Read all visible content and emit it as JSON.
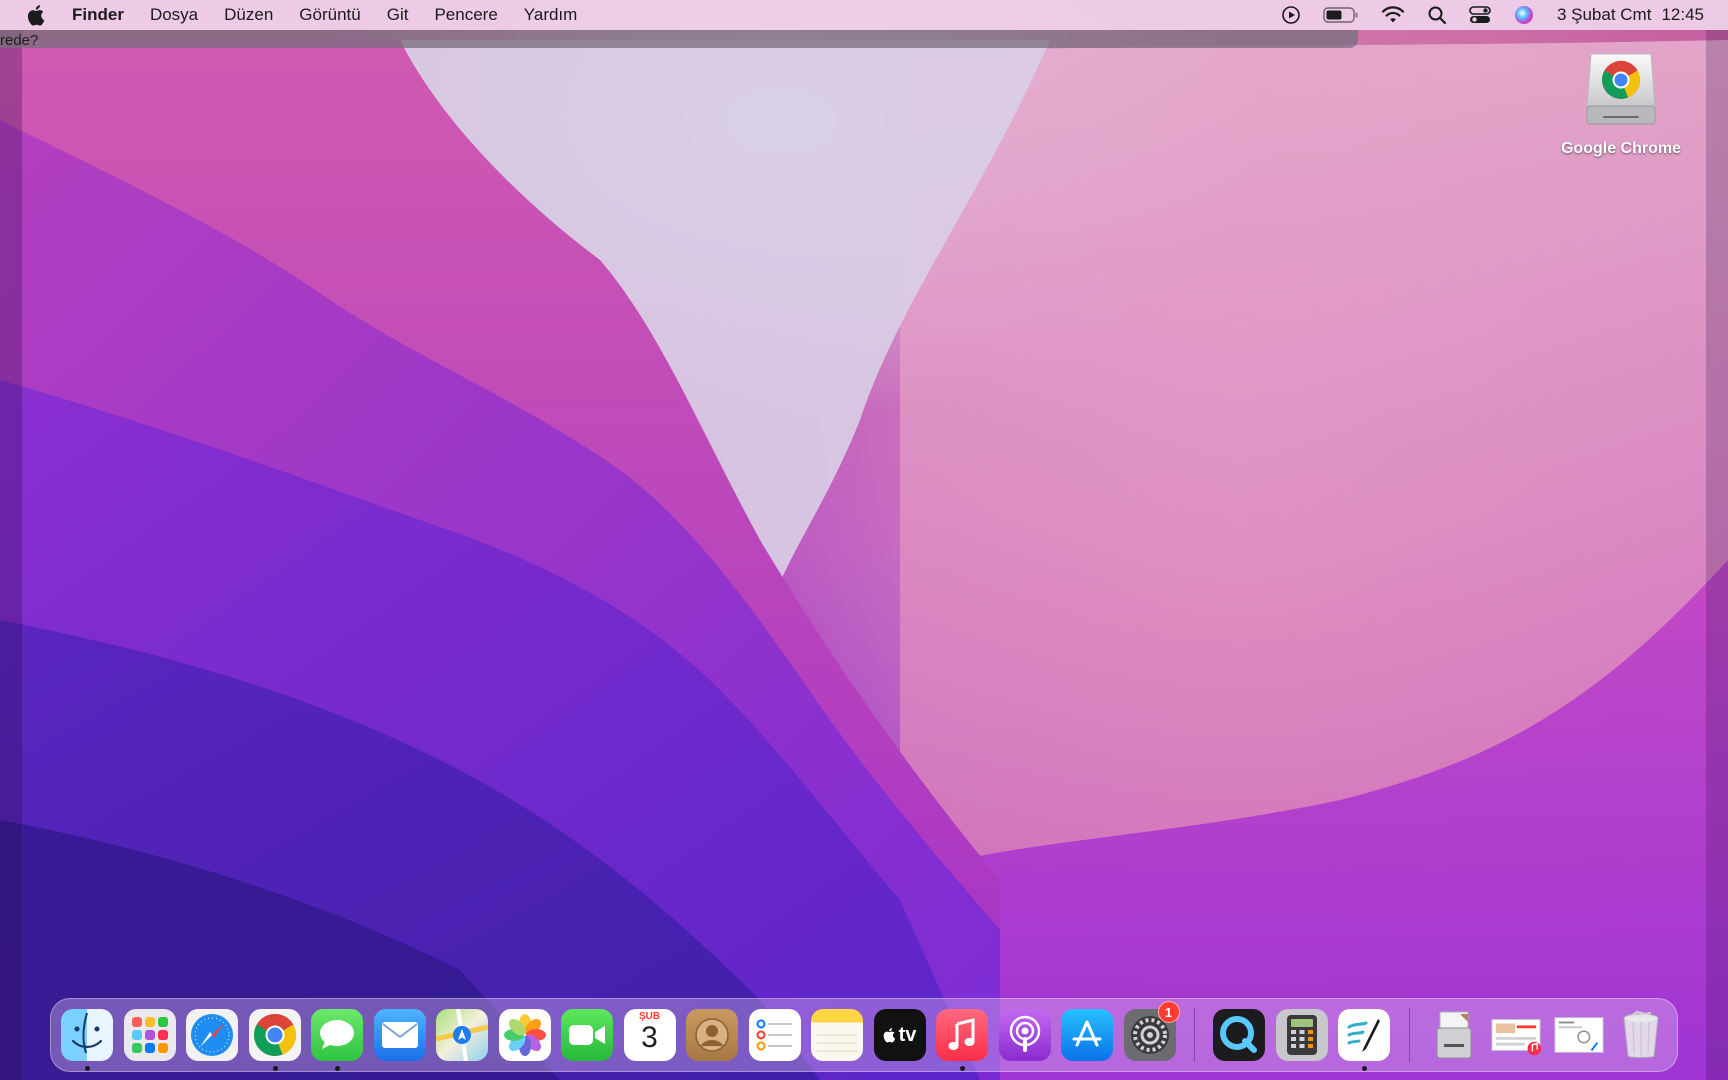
{
  "menubar": {
    "app_name": "Finder",
    "items": [
      "Dosya",
      "Düzen",
      "Görüntü",
      "Git",
      "Pencere",
      "Yardım"
    ],
    "status_icons": [
      "screen-recording-icon",
      "battery-icon",
      "wifi-icon",
      "spotlight-search-icon",
      "control-center-icon",
      "siri-icon"
    ],
    "date": "3 Şubat Cmt",
    "time": "12:45"
  },
  "background_window": {
    "title_fragment": "rede?"
  },
  "desktop": {
    "icons": [
      {
        "label": "Google Chrome",
        "icon": "chrome-disk-image-icon"
      }
    ]
  },
  "dock": {
    "apps": [
      {
        "name": "Finder",
        "icon": "finder-icon",
        "running": true
      },
      {
        "name": "Launchpad",
        "icon": "launchpad-icon",
        "running": false
      },
      {
        "name": "Safari",
        "icon": "safari-icon",
        "running": false
      },
      {
        "name": "Google Chrome",
        "icon": "chrome-icon",
        "running": true
      },
      {
        "name": "Messages",
        "icon": "messages-icon",
        "running": true
      },
      {
        "name": "Mail",
        "icon": "mail-icon",
        "running": false
      },
      {
        "name": "Maps",
        "icon": "maps-icon",
        "running": false
      },
      {
        "name": "Photos",
        "icon": "photos-icon",
        "running": false
      },
      {
        "name": "FaceTime",
        "icon": "facetime-icon",
        "running": false
      },
      {
        "name": "Calendar",
        "icon": "calendar-icon",
        "running": false,
        "month": "ŞUB",
        "day": "3"
      },
      {
        "name": "Contacts",
        "icon": "contacts-icon",
        "running": false
      },
      {
        "name": "Reminders",
        "icon": "reminders-icon",
        "running": false
      },
      {
        "name": "Notes",
        "icon": "notes-icon",
        "running": false
      },
      {
        "name": "Apple TV",
        "icon": "apple-tv-icon",
        "running": false,
        "text": "tv"
      },
      {
        "name": "Music",
        "icon": "music-icon",
        "running": true
      },
      {
        "name": "Podcasts",
        "icon": "podcasts-icon",
        "running": false
      },
      {
        "name": "App Store",
        "icon": "app-store-icon",
        "running": false
      },
      {
        "name": "System Preferences",
        "icon": "system-preferences-icon",
        "running": false,
        "badge": "1"
      }
    ],
    "extra_apps": [
      {
        "name": "QuickTime Player",
        "icon": "quicktime-icon",
        "running": false
      },
      {
        "name": "Calculator",
        "icon": "calculator-icon",
        "running": false
      },
      {
        "name": "Freeform",
        "icon": "freeform-icon",
        "running": true
      }
    ],
    "stacks": [
      {
        "name": "Downloads",
        "icon": "downloads-stack-icon"
      },
      {
        "name": "Documents",
        "icon": "documents-stack-icon"
      },
      {
        "name": "Recent Files",
        "icon": "recent-files-stack-icon"
      },
      {
        "name": "Trash",
        "icon": "trash-icon"
      }
    ]
  },
  "colors": {
    "menubar_bg": "#eecee8",
    "wallpaper_top": "#c7649f",
    "wallpaper_mid": "#b54cc2",
    "wallpaper_bottom": "#7a2ad0",
    "badge": "#ff3b30"
  }
}
